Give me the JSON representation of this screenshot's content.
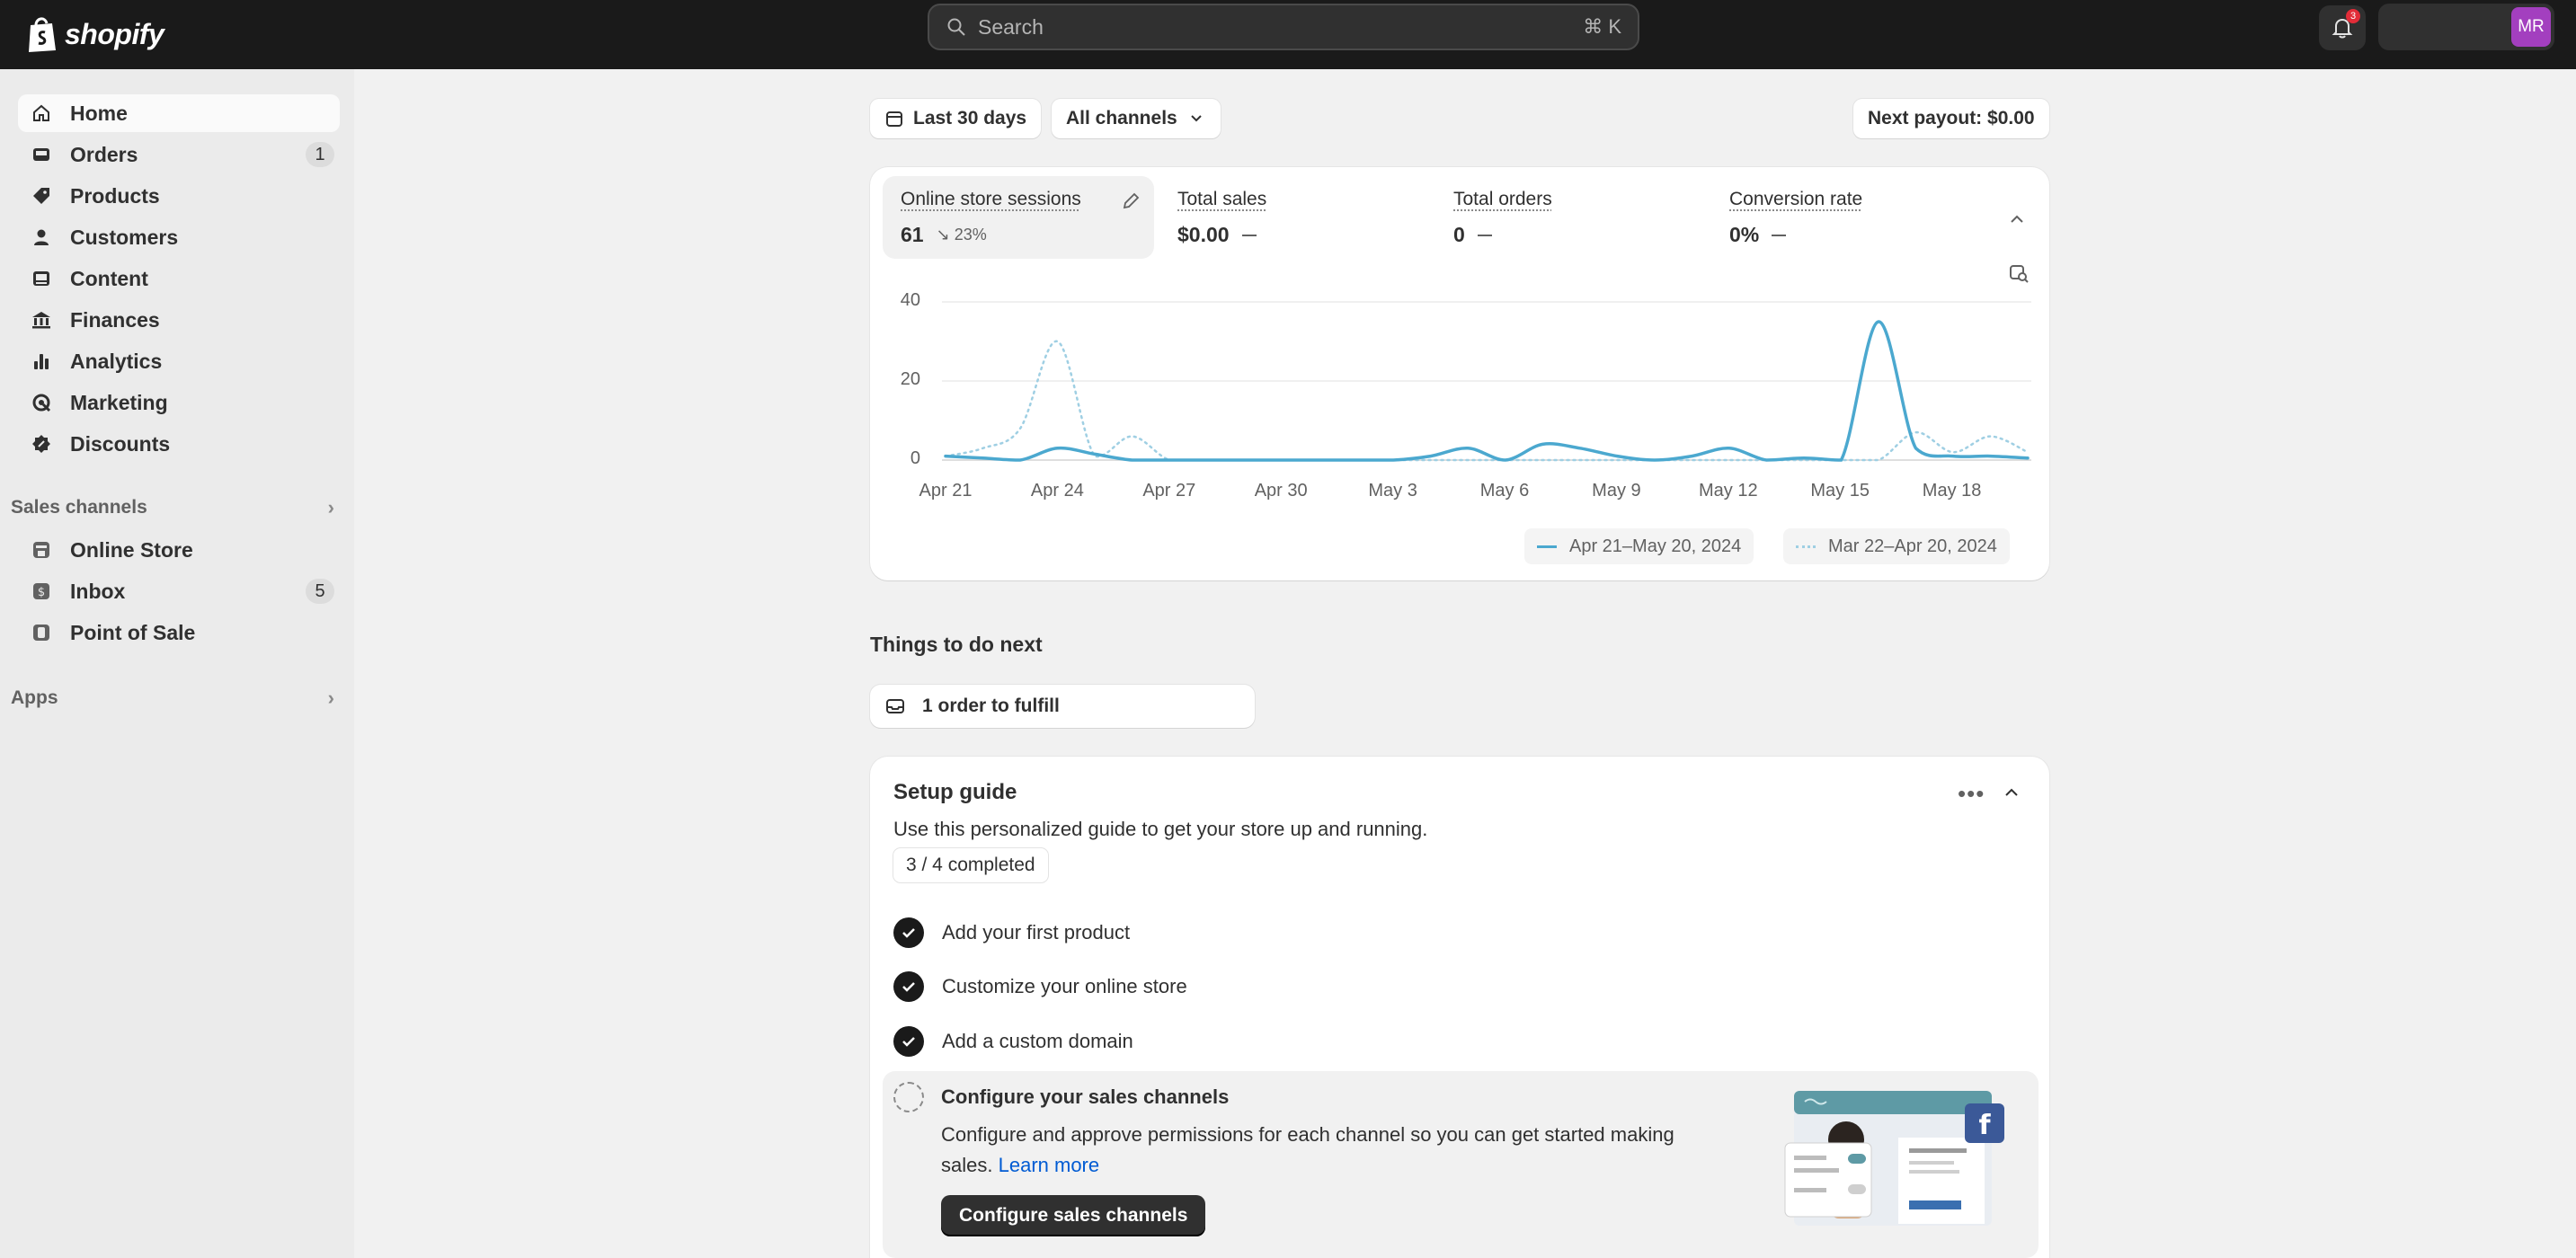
{
  "brand": {
    "name": "shopify"
  },
  "topbar": {
    "search_placeholder": "Search",
    "search_shortcut": "⌘ K",
    "notification_count": "3",
    "avatar_initials": "MR"
  },
  "sidebar": {
    "items": [
      {
        "label": "Home",
        "icon": "home-icon",
        "active": true
      },
      {
        "label": "Orders",
        "icon": "inbox-icon",
        "count": "1"
      },
      {
        "label": "Products",
        "icon": "tag-icon"
      },
      {
        "label": "Customers",
        "icon": "person-icon"
      },
      {
        "label": "Content",
        "icon": "image-icon"
      },
      {
        "label": "Finances",
        "icon": "bank-icon"
      },
      {
        "label": "Analytics",
        "icon": "bar-chart-icon"
      },
      {
        "label": "Marketing",
        "icon": "target-icon"
      },
      {
        "label": "Discounts",
        "icon": "discount-icon"
      }
    ],
    "sales_channels_label": "Sales channels",
    "channels": [
      {
        "label": "Online Store",
        "icon": "store-icon"
      },
      {
        "label": "Inbox",
        "icon": "chat-icon",
        "count": "5"
      },
      {
        "label": "Point of Sale",
        "icon": "pos-icon"
      }
    ],
    "apps_label": "Apps"
  },
  "filters": {
    "date_range": "Last 30 days",
    "channels": "All channels",
    "payout": "Next payout: $0.00"
  },
  "metrics": [
    {
      "label": "Online store sessions",
      "value": "61",
      "change": "23%"
    },
    {
      "label": "Total sales",
      "value": "$0.00"
    },
    {
      "label": "Total orders",
      "value": "0"
    },
    {
      "label": "Conversion rate",
      "value": "0%"
    }
  ],
  "chart_data": {
    "type": "line",
    "y_ticks": [
      "40",
      "20",
      "0"
    ],
    "ylim": [
      0,
      40
    ],
    "x_ticks": [
      "Apr 21",
      "Apr 24",
      "Apr 27",
      "Apr 30",
      "May 3",
      "May 6",
      "May 9",
      "May 12",
      "May 15",
      "May 18"
    ],
    "grid": true,
    "legend_position": "bottom-right",
    "series": [
      {
        "name": "Apr 21–May 20, 2024",
        "color": "#4ba8cf",
        "style": "solid",
        "values": [
          1,
          0.5,
          0,
          3,
          1.5,
          0,
          0,
          0,
          0,
          0,
          0,
          0,
          0,
          1,
          3,
          0,
          4,
          3,
          1,
          0,
          1,
          3,
          0,
          0.5,
          0,
          35,
          3,
          1,
          1,
          0.5
        ]
      },
      {
        "name": "Mar 22–Apr 20, 2024",
        "color": "#9fcfe3",
        "style": "dotted",
        "values": [
          1,
          3,
          8,
          30,
          1,
          6,
          0,
          0,
          0,
          0,
          0,
          0,
          0,
          0,
          0,
          0,
          0,
          0,
          0,
          0,
          0,
          0,
          0,
          0,
          0,
          0,
          7,
          2,
          6,
          2
        ]
      }
    ]
  },
  "todo": {
    "heading": "Things to do next",
    "items": [
      {
        "label": "1 order to fulfill"
      }
    ]
  },
  "setup_guide": {
    "title": "Setup guide",
    "description": "Use this personalized guide to get your store up and running.",
    "progress": "3 / 4 completed",
    "steps": [
      {
        "label": "Add your first product",
        "done": true
      },
      {
        "label": "Customize your online store",
        "done": true
      },
      {
        "label": "Add a custom domain",
        "done": true
      }
    ],
    "current": {
      "title": "Configure your sales channels",
      "description": "Configure and approve permissions for each channel so you can get started making sales.",
      "link": "Learn more",
      "button": "Configure sales channels"
    }
  },
  "colors": {
    "accent": "#4ba8cf",
    "avatar": "#a33fbf",
    "link": "#005bd3",
    "facebook": "#3b5998"
  }
}
